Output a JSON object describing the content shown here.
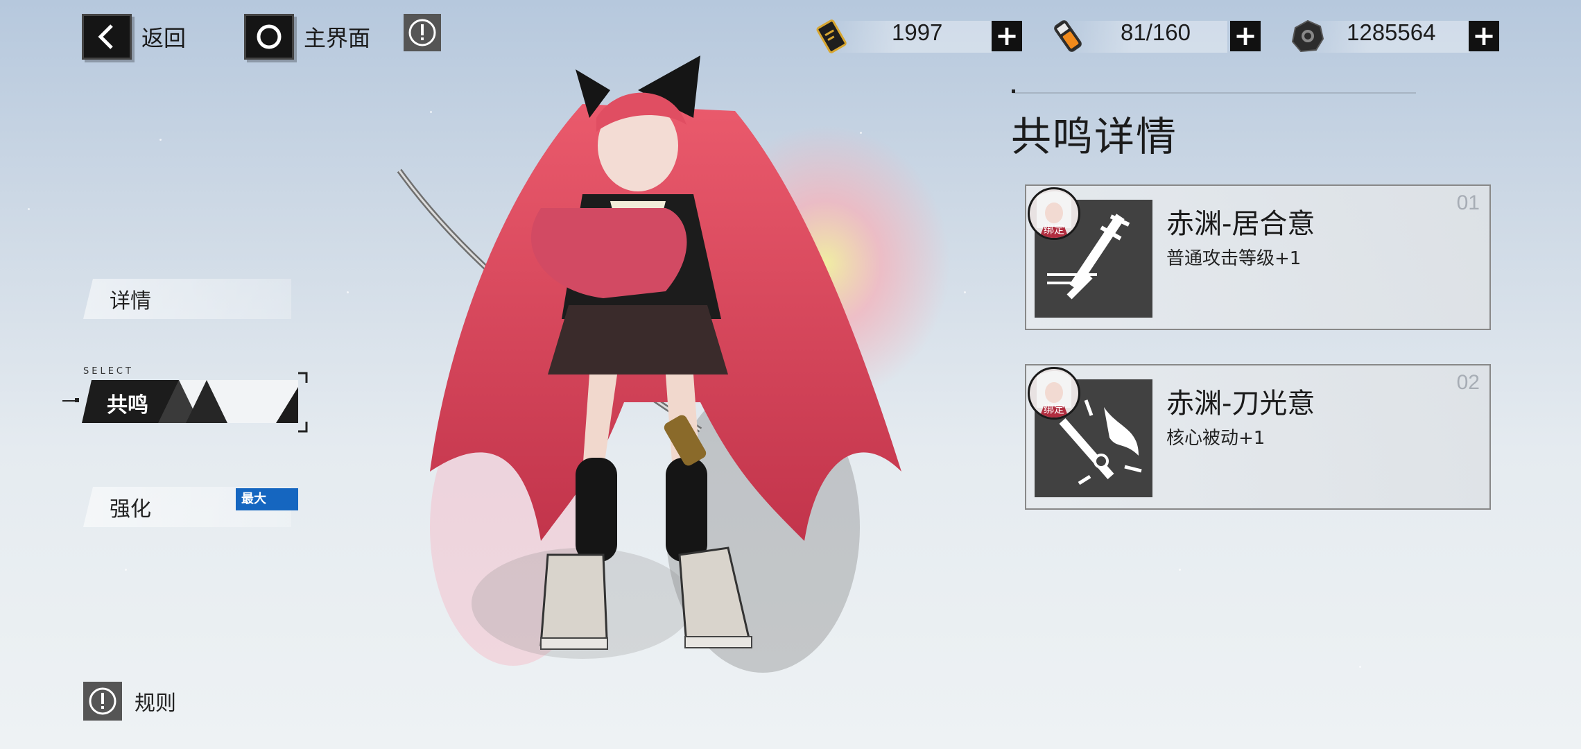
{
  "nav": {
    "back_label": "返回",
    "home_label": "主界面"
  },
  "currencies": [
    {
      "icon": "gold-card-icon",
      "value": "1997"
    },
    {
      "icon": "energy-battery-icon",
      "value": "81/160"
    },
    {
      "icon": "gear-coin-icon",
      "value": "1285564"
    }
  ],
  "menu": {
    "details_label": "详情",
    "select_tag": "SELECT",
    "resonance_label": "共鸣",
    "enhance_label": "强化",
    "enhance_badge": "最大"
  },
  "panel": {
    "title": "共鸣详情",
    "cards": [
      {
        "number": "01",
        "name": "赤渊-居合意",
        "desc": "普通攻击等级+1",
        "bind_label": "绑定"
      },
      {
        "number": "02",
        "name": "赤渊-刀光意",
        "desc": "核心被动+1",
        "bind_label": "绑定"
      }
    ]
  },
  "footer": {
    "rules_label": "规则"
  },
  "colors": {
    "accent_blue": "#1566c0",
    "dark": "#151515",
    "hair": "#e0576a"
  }
}
